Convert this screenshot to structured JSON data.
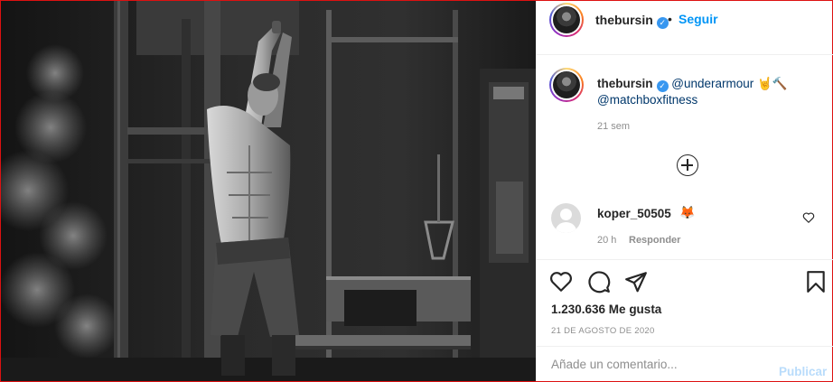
{
  "post": {
    "image_alt": "Shirtless athlete in a dark gym swinging a sledgehammer overhead, black and white photo"
  },
  "header": {
    "username": "thebursin",
    "verified_glyph": "✓",
    "separator": "•",
    "follow_label": "Seguir"
  },
  "caption": {
    "username": "thebursin",
    "mention_1": "@underarmour",
    "emojis": "🤘🔨",
    "mention_2": "@matchboxfitness",
    "time": "21 sem"
  },
  "load_more_icon": "plus-circle-icon",
  "comments": [
    {
      "username": "koper_50505",
      "text": "🦊",
      "time": "20 h",
      "reply_label": "Responder"
    }
  ],
  "actions": {
    "icons": [
      "heart-icon",
      "comment-icon",
      "share-icon",
      "bookmark-icon"
    ],
    "likes": "1.230.636 Me gusta",
    "date": "21 DE AGOSTO DE 2020"
  },
  "composer": {
    "placeholder": "Añade un comentario...",
    "post_label": "Publicar"
  },
  "colors": {
    "link": "#0095f6",
    "verified": "#3897f0",
    "mention": "#00376b",
    "muted": "#8e8e8e",
    "post_disabled": "#b9dcfb",
    "window_border": "#dd1111"
  }
}
